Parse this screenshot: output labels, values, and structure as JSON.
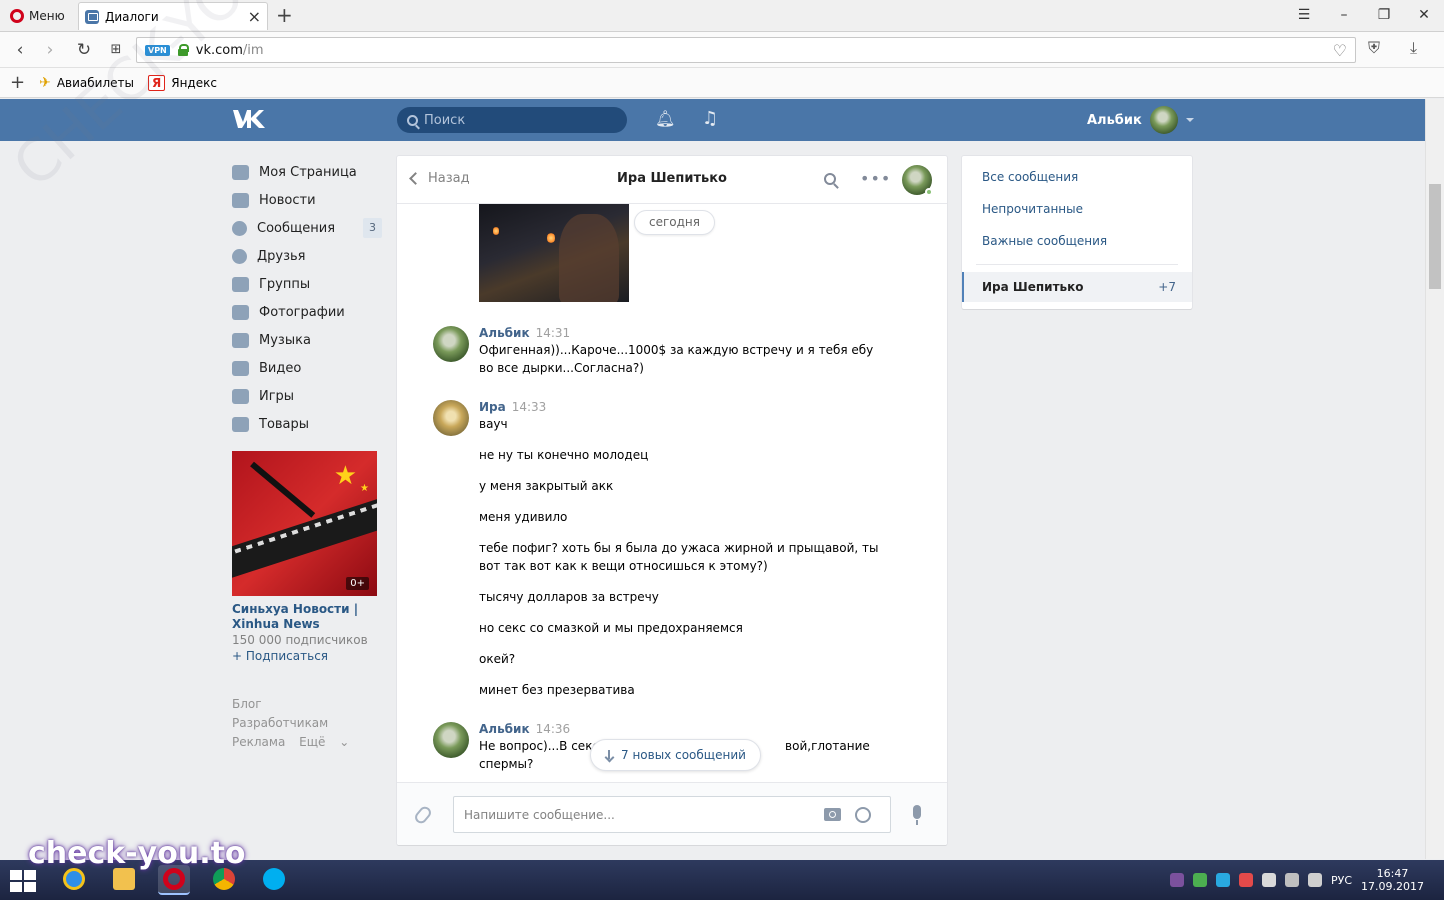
{
  "browser": {
    "menu_label": "Меню",
    "tab_title": "Диалоги",
    "url_host": "vk.com",
    "url_path": "/im",
    "bookmarks": [
      "Авиабилеты",
      "Яндекс"
    ],
    "vpn_label": "VPN"
  },
  "vk": {
    "search_placeholder": "Поиск",
    "user_name": "Альбик"
  },
  "leftnav": {
    "items": [
      {
        "label": "Моя Страница"
      },
      {
        "label": "Новости"
      },
      {
        "label": "Сообщения",
        "badge": "3"
      },
      {
        "label": "Друзья"
      },
      {
        "label": "Группы"
      },
      {
        "label": "Фотографии"
      },
      {
        "label": "Музыка"
      },
      {
        "label": "Видео"
      },
      {
        "label": "Игры"
      },
      {
        "label": "Товары"
      }
    ]
  },
  "ad": {
    "title": "Синьхуа Новости | Xinhua News",
    "subscribers": "150 000 подписчиков",
    "subscribe": "+ Подписаться",
    "age": "0+"
  },
  "footer": {
    "links": [
      "Блог",
      "Разработчикам",
      "Реклама",
      "Ещё"
    ]
  },
  "chat": {
    "back_label": "Назад",
    "title": "Ира Шепитько",
    "date_label": "сегодня",
    "messages": [
      {
        "author": "Альбик",
        "time": "14:31",
        "lines": [
          "Офигенная))...Кароче...1000$ за каждую встречу и я тебя ебу",
          "во все дырки...Согласна?)"
        ]
      },
      {
        "author": "Ира",
        "time": "14:33",
        "lines": [
          "вауч",
          "не ну ты конечно молодец",
          "у меня закрытый акк",
          "меня удивило",
          "тебе пофиг? хоть бы я была до ужаса жирной и прыщавой, ты",
          "вот так вот как к вещи относишься к этому?)",
          "тысячу долларов за встречу",
          "но секс со смазкой и мы предохраняемся",
          "окей?",
          "минет без презерватива"
        ]
      },
      {
        "author": "Альбик",
        "time": "14:36",
        "lines": [
          "Не вопрос)...В секс",
          "спермы?"
        ],
        "hidden_tail": "вой,глотание"
      }
    ],
    "new_messages_label": "7 новых сообщений",
    "input_placeholder": "Напишите сообщение..."
  },
  "rpanel": {
    "links": [
      "Все сообщения",
      "Непрочитанные",
      "Важные сообщения"
    ],
    "selected_name": "Ира Шепитько",
    "selected_count": "+7"
  },
  "taskbar": {
    "lang": "РУС",
    "time": "16:47",
    "date": "17.09.2017"
  },
  "watermarks": {
    "bottom": "check-you.to",
    "diagonal": "CHECK-YOU.ME"
  }
}
